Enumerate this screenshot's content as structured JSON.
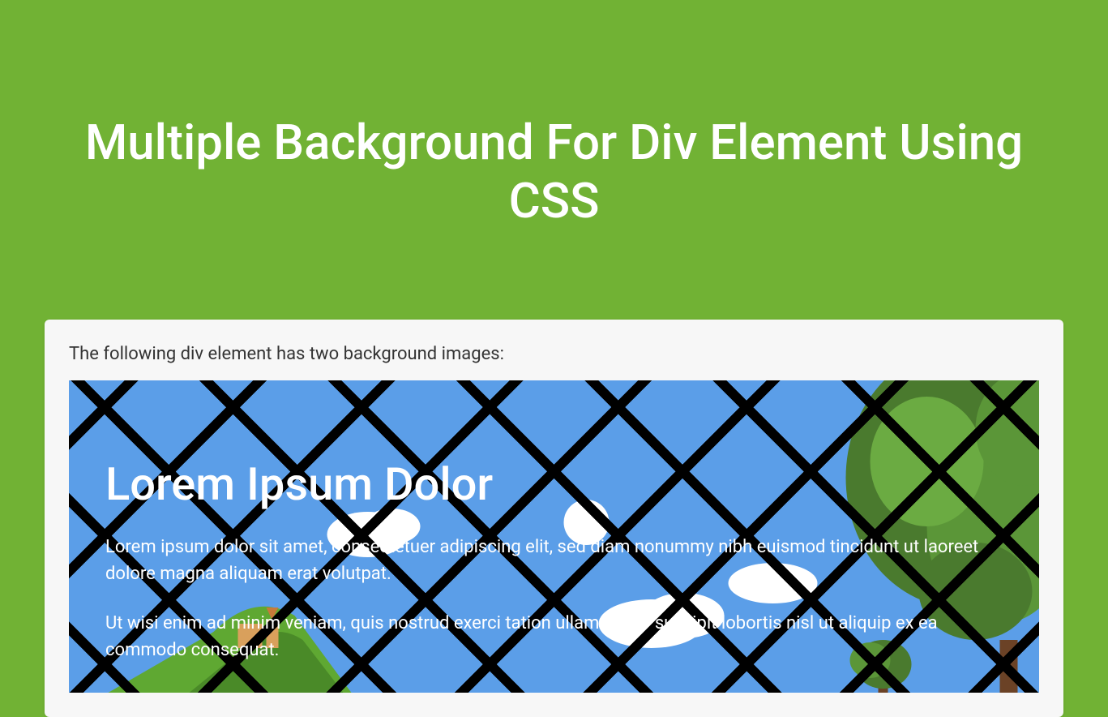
{
  "header": {
    "title": "Multiple Background For Div Element Using CSS"
  },
  "content": {
    "intro": "The following div element has two background images:",
    "demo": {
      "heading": "Lorem Ipsum Dolor",
      "paragraph1": "Lorem ipsum dolor sit amet, consectetuer adipiscing elit, sed diam nonummy nibh euismod tincidunt ut laoreet dolore magna aliquam erat volutpat.",
      "paragraph2": "Ut wisi enim ad minim veniam, quis nostrud exerci tation ullamcorper suscipit lobortis nisl ut aliquip ex ea commodo consequat."
    }
  }
}
